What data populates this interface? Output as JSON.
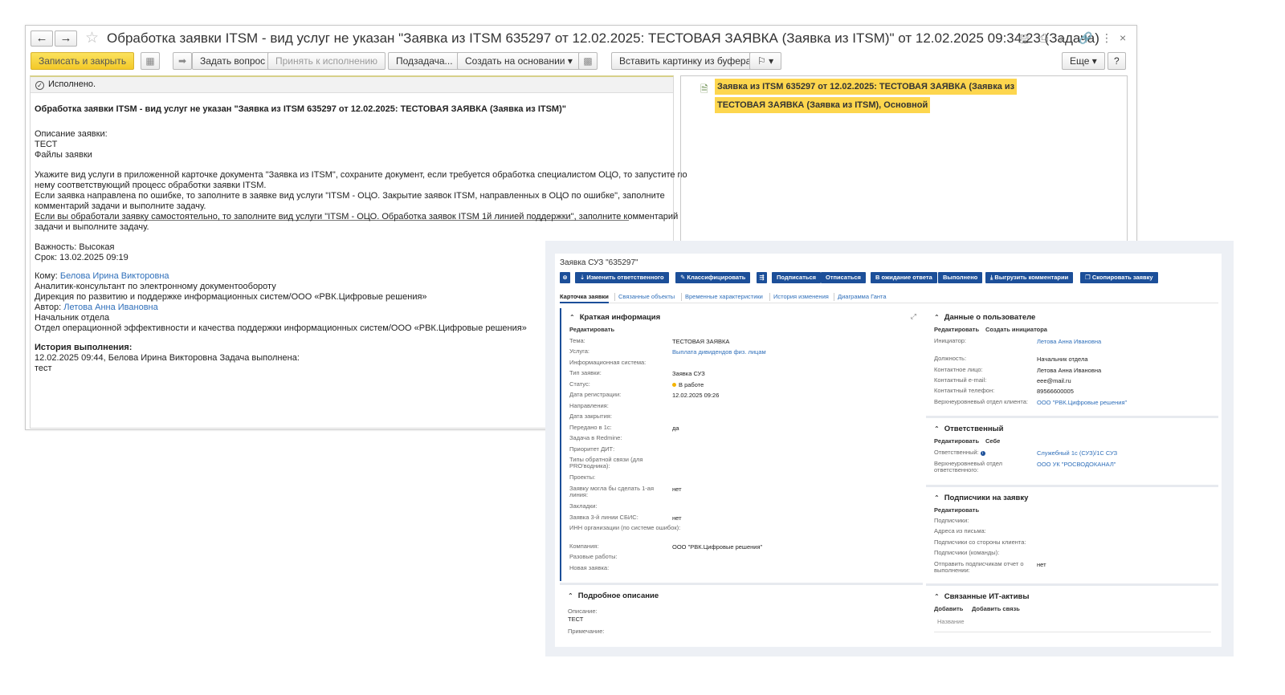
{
  "window1": {
    "title": "Обработка заявки ITSM - вид услуг не указан \"Заявка из ITSM 635297 от 12.02.2025: ТЕСТОВАЯ ЗАЯВКА (Заявка из ITSM)\" от 12.02.2025 09:34:23 (Задача)",
    "nav": {
      "back": "←",
      "forward": "→",
      "star": "☆"
    },
    "window_icons": {
      "save": "🖫",
      "print": "⎙",
      "preview": "⌕",
      "link": "🔗",
      "more": "⋮",
      "close": "×"
    },
    "toolbar": {
      "write_close": "Записать и закрыть",
      "ask": "Задать вопрос",
      "accept": "Принять к исполнению",
      "subtask": "Подзадача...",
      "create_based": "Создать на основании",
      "insert_picture": "Вставить картинку из буфера",
      "flag": "⚐",
      "more": "Еще",
      "help": "?"
    },
    "status": "Исполнено.",
    "heading": "Обработка заявки ITSM - вид услуг не указан \"Заявка из ITSM 635297 от 12.02.2025: ТЕСТОВАЯ ЗАЯВКА (Заявка из ITSM)\"",
    "description_label": "Описание заявки:",
    "description_value": "ТЕСТ",
    "files_label": "Файлы заявки",
    "instructions": [
      "Укажите вид услуги в приложенной карточке документа \"Заявка из ITSM\", сохраните документ, если требуется обработка специалистом ОЦО, то запустите по",
      "нему соответствующий процесс обработки заявки ITSM.",
      "Если заявка направлена по ошибке, то заполните в заявке вид услуги \"ITSM - ОЦО. Закрытие заявок ITSM, направленных в ОЦО по ошибке\", заполните",
      "комментарий задачи и выполните задачу.",
      "Если вы обработали заявку самостоятельно, то заполните вид услуги \"ITSM - ОЦО. Обработка заявок ITSM 1й линией поддержки\", заполните комментарий",
      "задачи и выполните задачу."
    ],
    "importance": "Важность: Высокая",
    "deadline": "Срок: 13.02.2025 09:19",
    "to_label": "Кому:",
    "to_name": "Белова Ирина Викторовна",
    "to_lines": [
      "Аналитик-консультант по электронному документообороту",
      "Дирекция по развитию и поддержке информационных систем/ООО «РВК.Цифровые решения»"
    ],
    "author_label": "Автор:",
    "author_name": "Летова Анна Ивановна",
    "author_lines": [
      "Начальник отдела",
      "Отдел операционной эффективности и качества поддержки информационных систем/ООО «РВК.Цифровые решения»"
    ],
    "history_label": "История выполнения:",
    "history_line": "12.02.2025 09:44,  Белова Ирина Викторовна   Задача выполнена:",
    "history_comment": "тест",
    "right_link_line1": "Заявка из ITSM 635297 от 12.02.2025: ТЕСТОВАЯ ЗАЯВКА (Заявка из",
    "right_link_line2": "ТЕСТОВАЯ ЗАЯВКА (Заявка из ITSM), Основной"
  },
  "window2": {
    "title": "Заявка СУЗ \"635297\"",
    "buttons": {
      "close": "⊗",
      "change_responsible": "Изменить ответственного",
      "classify": "Классифицировать",
      "route": "⇶",
      "subscribe": "Подписаться",
      "unsubscribe": "Отписаться",
      "waiting": "В ожидание ответа",
      "done": "Выполнено",
      "export_comments": "Выгрузить комментарии",
      "copy_request": "Скопировать заявку"
    },
    "tabs": [
      "Карточка заявки",
      "Связанные объекты",
      "Временные характеристики",
      "История изменения",
      "Диаграмма Ганта"
    ],
    "short_info": {
      "header": "Краткая информация",
      "edit": "Редактировать",
      "fields": [
        {
          "k": "Тема:",
          "v": "ТЕСТОВАЯ ЗАЯВКА"
        },
        {
          "k": "Услуга:",
          "v": "Выплата дивидендов физ. лицам"
        },
        {
          "k": "Информационная система:",
          "v": ""
        },
        {
          "k": "Тип заявки:",
          "v": "Заявка СУЗ"
        },
        {
          "k": "Статус:",
          "v": "В работе"
        },
        {
          "k": "Дата регистрации:",
          "v": "12.02.2025 09:26"
        },
        {
          "k": "Направления:",
          "v": ""
        },
        {
          "k": "Дата закрытия:",
          "v": ""
        },
        {
          "k": "Передано в 1с:",
          "v": "да"
        },
        {
          "k": "Задача в Redmine:",
          "v": ""
        },
        {
          "k": "Приоритет ДИТ:",
          "v": ""
        },
        {
          "k": "Типы обратной связи (для PRO'водника):",
          "v": ""
        },
        {
          "k": "Проекты:",
          "v": ""
        },
        {
          "k": "Заявку могла бы сделать 1-ая линия:",
          "v": "нет"
        },
        {
          "k": "Закладки:",
          "v": ""
        },
        {
          "k": "Заявка 3-й линии СБИС:",
          "v": "нет"
        },
        {
          "k": "ИНН организации (по системе ошибок):",
          "v": ""
        },
        {
          "k": "Компания:",
          "v": "ООО \"РВК.Цифровые решения\""
        },
        {
          "k": "Разовые работы:",
          "v": ""
        },
        {
          "k": "Новая заявка:",
          "v": ""
        }
      ]
    },
    "detail": {
      "header": "Подробное описание",
      "desc_label": "Описание:",
      "desc_value": "ТЕСТ",
      "note_label": "Примечание:"
    },
    "user_data": {
      "header": "Данные о пользователе",
      "edit": "Редактировать",
      "create_initiator": "Создать инициатора",
      "fields": [
        {
          "k": "Инициатор:",
          "v": "Летова Анна Ивановна"
        },
        {
          "k": "Должность:",
          "v": "Начальник отдела"
        },
        {
          "k": "Контактное лицо:",
          "v": "Летова Анна Ивановна"
        },
        {
          "k": "Контактный e-mail:",
          "v": "eee@mail.ru"
        },
        {
          "k": "Контактный телефон:",
          "v": "89566600005"
        },
        {
          "k": "Верхнеуровневый отдел клиента:",
          "v": "ООО \"РВК.Цифровые решения\""
        }
      ]
    },
    "responsible": {
      "header": "Ответственный",
      "edit": "Редактировать",
      "self": "Себе",
      "resp_label": "Ответственный:",
      "resp_value": "Служебный 1с (СУЗ)/1С СУЗ",
      "dept_label": "Верхнеуровневый отдел ответственного:",
      "dept_value": "ООО УК \"РОСВОДОКАНАЛ\""
    },
    "subscribers": {
      "header": "Подписчики на заявку",
      "edit": "Редактировать",
      "fields": [
        {
          "k": "Подписчики:",
          "v": ""
        },
        {
          "k": "Адреса из письма:",
          "v": ""
        },
        {
          "k": "Подписчики со стороны клиента:",
          "v": ""
        },
        {
          "k": "Подписчики (команды):",
          "v": ""
        },
        {
          "k": "Отправить подписчикам отчет о выполнении:",
          "v": "нет"
        }
      ]
    },
    "assets": {
      "header": "Связанные ИТ-активы",
      "add": "Добавить",
      "add_link": "Добавить связь",
      "col_name": "Название"
    },
    "colors": {
      "accent": "#1c4f99",
      "link": "#2f6fba",
      "highlight": "#fdd64e",
      "primary_button": "#f3c928"
    }
  }
}
